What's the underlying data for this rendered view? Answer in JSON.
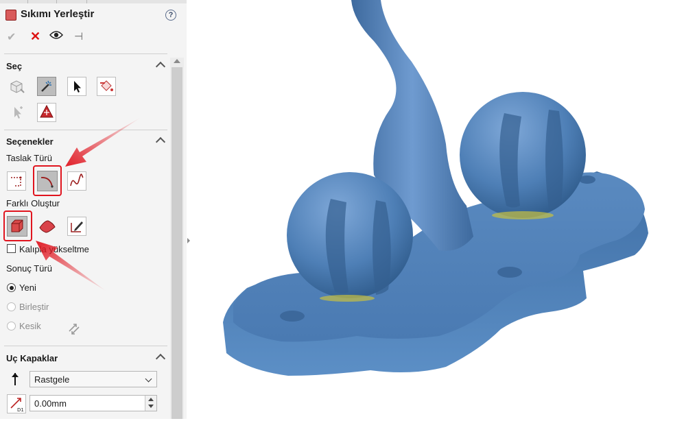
{
  "feature": {
    "title": "Sıkımı Yerleştir",
    "help_icon": "help-icon",
    "ok_icon": "checkmark-icon",
    "cancel_icon": "close-icon",
    "preview_icon": "eye-icon",
    "pin_icon": "pushpin-icon"
  },
  "sections": {
    "select": {
      "title": "Seç"
    },
    "options": {
      "title": "Seçenekler"
    },
    "end_caps": {
      "title": "Uç Kapaklar"
    }
  },
  "options": {
    "sketch_type_label": "Taslak Türü",
    "create_different_label": "Farklı Oluştur",
    "mold_lift_label": "Kalıpla yükseltme",
    "mold_lift_checked": false,
    "result_type_label": "Sonuç Türü",
    "result_types": [
      {
        "label": "Yeni",
        "selected": true,
        "enabled": true
      },
      {
        "label": "Birleştir",
        "selected": false,
        "enabled": false
      },
      {
        "label": "Kesik",
        "selected": false,
        "enabled": false
      }
    ]
  },
  "end_caps": {
    "direction_select": "Rastgele",
    "depth_value": "0.00mm",
    "depth_icon_label": "D1"
  },
  "colors": {
    "accent_red": "#e0141e",
    "model_blue": "#4f81b9",
    "panel_bg": "#f4f4f4"
  }
}
